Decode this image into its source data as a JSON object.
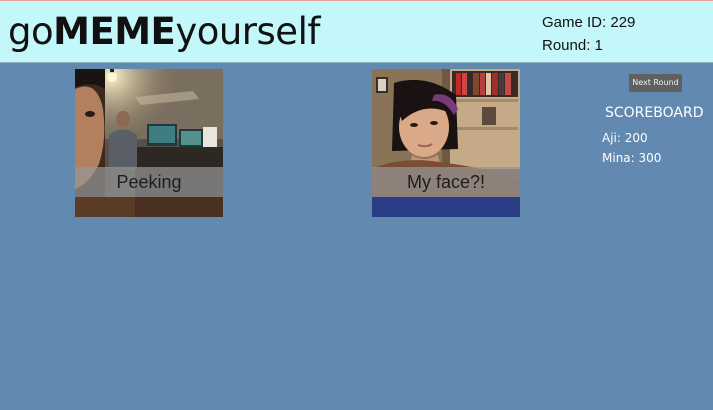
{
  "header": {
    "logo_prefix": "go",
    "logo_bold": "MEME",
    "logo_suffix": "yourself",
    "game_id_label": "Game ID:",
    "game_id": "229",
    "round_label": "Round:",
    "round": "1"
  },
  "memes": [
    {
      "caption": "Peeking"
    },
    {
      "caption": "My face?!"
    }
  ],
  "controls": {
    "next_round_label": "Next Round"
  },
  "scoreboard": {
    "title": "SCOREBOARD",
    "players": [
      {
        "name": "Aji",
        "score": "200"
      },
      {
        "name": "Mina",
        "score": "300"
      }
    ]
  },
  "colors": {
    "background": "#6289b0",
    "header": "#c4f7fa",
    "button": "#606060"
  }
}
